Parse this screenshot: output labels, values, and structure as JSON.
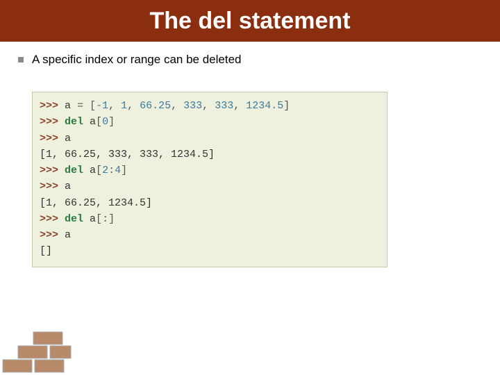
{
  "title": "The del statement",
  "bullet": "A specific index or range can be deleted",
  "code": {
    "l1_prompt": ">>> ",
    "l1_a": "a ",
    "l1_eq": "= ",
    "l1_lb": "[",
    "l1_n1": "-1",
    "l1_c1": ", ",
    "l1_n2": "1",
    "l1_c2": ", ",
    "l1_n3": "66.25",
    "l1_c3": ", ",
    "l1_n4": "333",
    "l1_c4": ", ",
    "l1_n5": "333",
    "l1_c5": ", ",
    "l1_n6": "1234.5",
    "l1_rb": "]",
    "l2_prompt": ">>> ",
    "l2_del": "del ",
    "l2_var": "a",
    "l2_lb": "[",
    "l2_idx": "0",
    "l2_rb": "]",
    "l3_prompt": ">>> ",
    "l3_var": "a",
    "l4_out": "[1, 66.25, 333, 333, 1234.5]",
    "l5_prompt": ">>> ",
    "l5_del": "del ",
    "l5_var": "a",
    "l5_lb": "[",
    "l5_i1": "2",
    "l5_colon": ":",
    "l5_i2": "4",
    "l5_rb": "]",
    "l6_prompt": ">>> ",
    "l6_var": "a",
    "l7_out": "[1, 66.25, 1234.5]",
    "l8_prompt": ">>> ",
    "l8_del": "del ",
    "l8_var": "a",
    "l8_lb": "[",
    "l8_colon": ":",
    "l8_rb": "]",
    "l9_prompt": ">>> ",
    "l9_var": "a",
    "l10_out": "[]"
  }
}
